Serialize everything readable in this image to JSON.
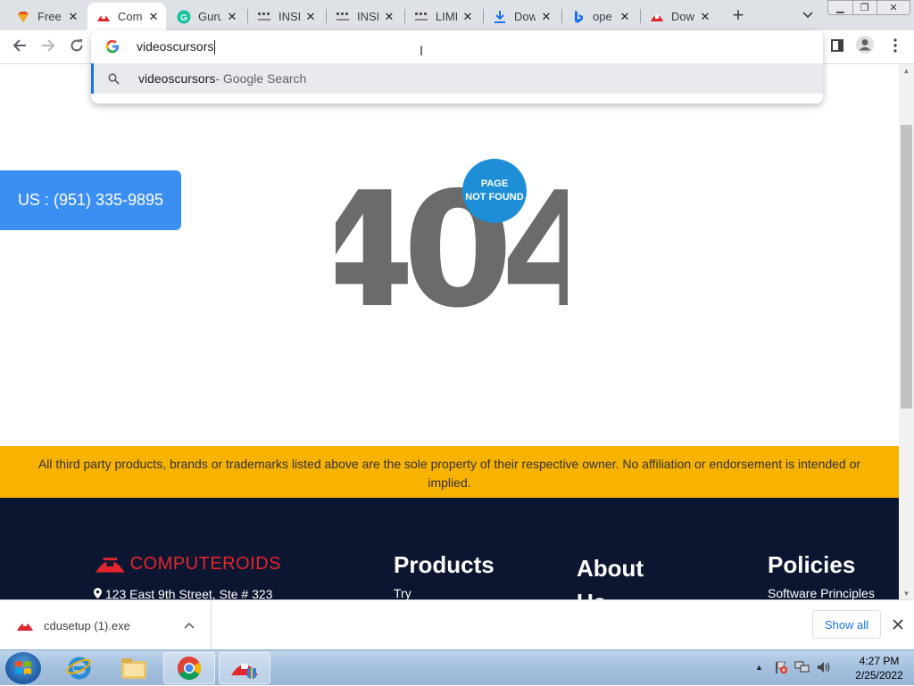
{
  "tabs": [
    {
      "title": "Free",
      "icon": "gem-favicon-icon"
    },
    {
      "title": "Com",
      "icon": "computeroids-favicon-icon",
      "active": true
    },
    {
      "title": "Guru",
      "icon": "grammarly-favicon-icon"
    },
    {
      "title": "INSI",
      "icon": "qr-favicon-icon"
    },
    {
      "title": "INSI",
      "icon": "qr-favicon-icon"
    },
    {
      "title": "LIMI",
      "icon": "qr-favicon-icon"
    },
    {
      "title": "Dow",
      "icon": "download-favicon-icon"
    },
    {
      "title": "ope",
      "icon": "bing-favicon-icon"
    },
    {
      "title": "Dow",
      "icon": "computeroids-favicon-icon"
    }
  ],
  "omnibox": {
    "value": "videoscursors",
    "suggestion": {
      "query": "videoscursors",
      "source": " - Google Search"
    }
  },
  "page": {
    "phone": "US : (951) 335-9895",
    "error_code": "404",
    "badge_line1": "PAGE",
    "badge_line2": "NOT FOUND",
    "disclaimer": "All third party products, brands or trademarks listed above are the sole property of their respective owner. No affiliation or endorsement is intended or implied.",
    "footer": {
      "logo_text": "COMPUTEROIDS",
      "address": "123 East 9th Street, Ste # 323",
      "col1": {
        "heading": "Products",
        "link": "Try"
      },
      "col2": {
        "heading": "About Us"
      },
      "col3": {
        "heading": "Policies",
        "link": "Software Principles"
      }
    }
  },
  "downloads": {
    "file": "cdusetup (1).exe",
    "show_all": "Show all"
  },
  "taskbar": {
    "time": "4:27 PM",
    "date": "2/25/2022"
  },
  "colors": {
    "phone_button": "#3b8ff2",
    "badge": "#1e8fd7",
    "disclaimer_bg": "#f8b200",
    "footer_bg": "#0d1631",
    "logo_red": "#e2262e"
  }
}
